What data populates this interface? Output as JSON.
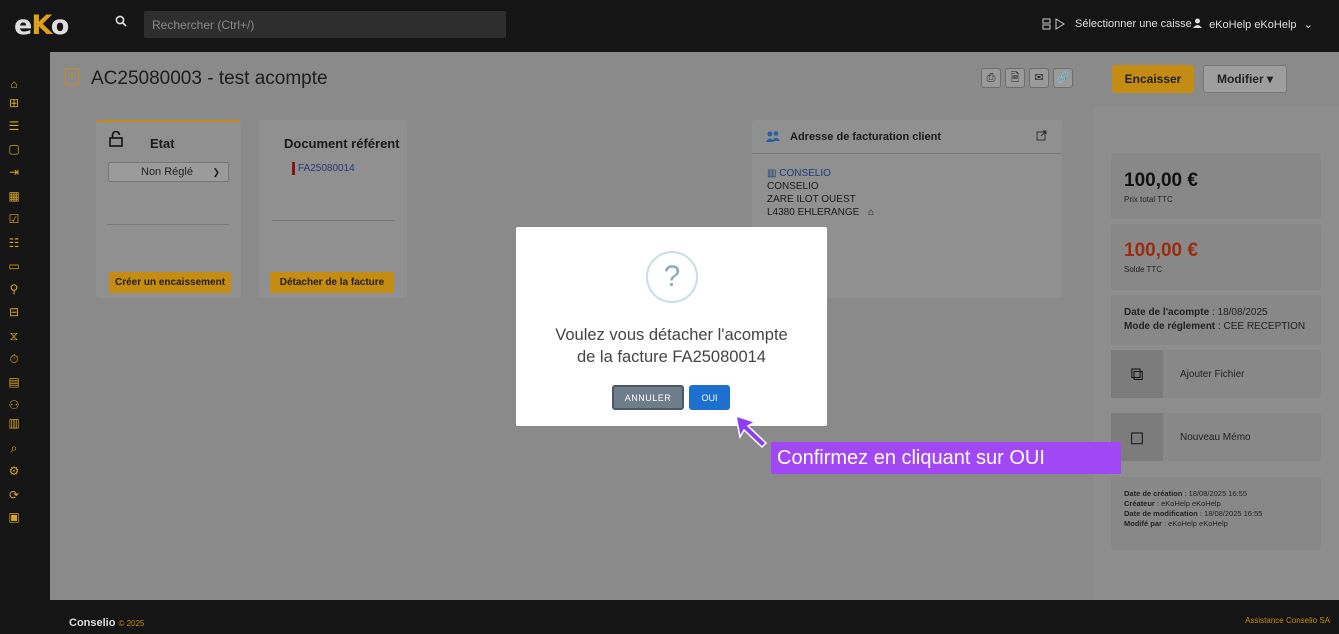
{
  "app": {
    "logo_main": "e",
    "logo_k": "K",
    "logo_end": "o"
  },
  "search": {
    "placeholder": "Rechercher (Ctrl+/)"
  },
  "header": {
    "register_label": "Sélectionner une caisse",
    "user_label": "eKoHelp eKoHelp",
    "user_chevron": "⌄"
  },
  "sidebar_icons": [
    "home-icon",
    "add-icon",
    "list-icon",
    "document-icon",
    "export-icon",
    "calendar-icon",
    "checklist-icon",
    "tasks-icon",
    "folder-icon",
    "filter-icon",
    "hierarchy-icon",
    "stats-icon",
    "timer-icon",
    "calculator-icon",
    "team-icon",
    "chart-icon",
    "search-icon",
    "settings-icon",
    "cycle-icon",
    "register-icon"
  ],
  "page": {
    "doc_icon_text": "AC",
    "title": "AC25080003 - test acompte"
  },
  "toolbar": {
    "print": "⎙",
    "pdf": "🗎",
    "mail": "✉",
    "attach": "🔗",
    "encaisser": "Encaisser",
    "modifier": "Modifier",
    "modifier_chevron": "▾"
  },
  "etat_card": {
    "title": "Etat",
    "status": "Non Réglé",
    "action": "Créer un encaissement"
  },
  "ref_card": {
    "title": "Document référent",
    "link": "FA25080014",
    "action": "Détacher de la facture"
  },
  "address": {
    "title": "Adresse de facturation client",
    "company_link": "CONSELIO",
    "lines": [
      "CONSELIO",
      "ZARE ILOT OUEST",
      "L4380 EHLERANGE"
    ]
  },
  "summary": {
    "total": "100,00 €",
    "total_label": "Prix total TTC",
    "balance": "100,00 €",
    "balance_label": "Solde TTC",
    "date_label": "Date de l'acompte",
    "date_value": " : 18/08/2025",
    "mode_label": "Mode de réglement",
    "mode_value": " : CEE RECEPTION",
    "add_file": "Ajouter Fichier",
    "new_memo": "Nouveau Mémo",
    "meta": [
      {
        "label": "Date de création",
        "value": " : 18/08/2025 16:55"
      },
      {
        "label": "Créateur",
        "value": " : eKoHelp eKoHelp"
      },
      {
        "label": "Date de modification",
        "value": " : 18/08/2025 16:55"
      },
      {
        "label": "Modifé par",
        "value": " : eKoHelp eKoHelp"
      }
    ]
  },
  "modal": {
    "icon": "?",
    "line1": "Voulez vous détacher l'acompte",
    "line2": "de la facture FA25080014",
    "cancel": "ANNULER",
    "confirm": "OUI"
  },
  "tooltip": {
    "text": "Confirmez en cliquant sur OUI"
  },
  "footer": {
    "brand": "Conselio",
    "year": "© 2025",
    "support": "Assistance Conselio SA"
  },
  "colors": {
    "accent": "#c58c14",
    "confirm": "#1d6fd0",
    "tooltip": "#a147f5",
    "balance": "#9b2c10"
  }
}
